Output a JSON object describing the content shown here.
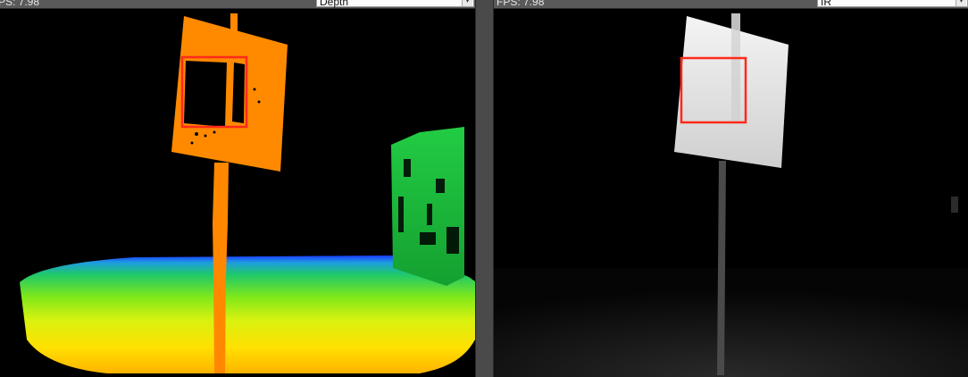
{
  "left_view": {
    "fps_text": "PS: 7.98",
    "stream_mode": "Depth",
    "roi_color": "#ff2a1a"
  },
  "right_view": {
    "fps_text": "FPS: 7.98",
    "stream_mode": "IR",
    "roi_color": "#ff2a1a"
  },
  "icons": {
    "dropdown": "chevron-down-icon"
  }
}
